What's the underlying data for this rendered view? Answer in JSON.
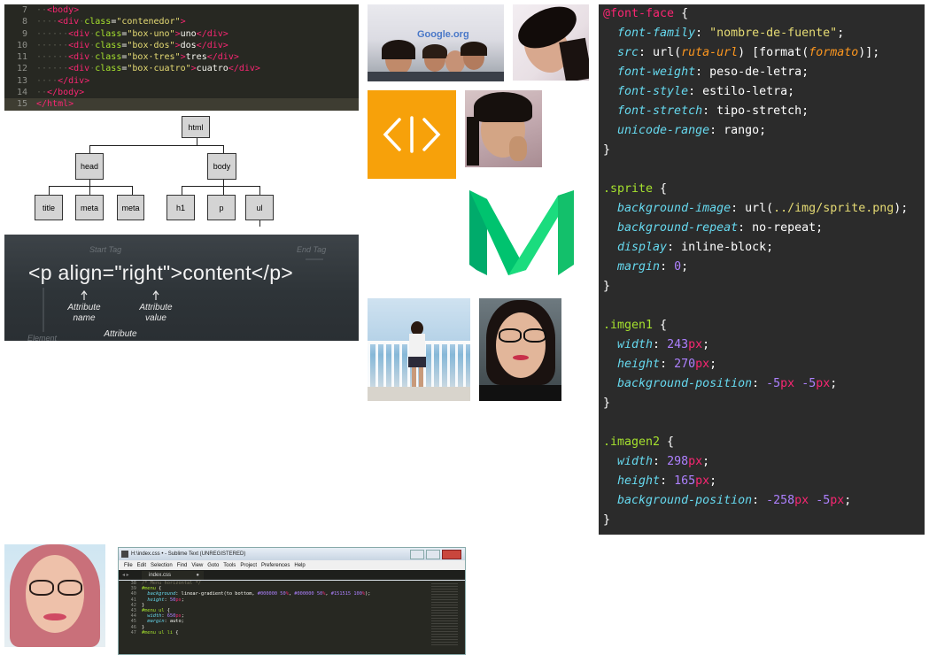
{
  "html_code": {
    "lines": [
      {
        "n": "7",
        "segs": [
          [
            "dt",
            "··"
          ],
          [
            "tg",
            "<body>"
          ]
        ]
      },
      {
        "n": "8",
        "segs": [
          [
            "dt",
            "····"
          ],
          [
            "tg",
            "<div"
          ],
          [
            "dt",
            "·"
          ],
          [
            "at",
            "class"
          ],
          [
            "plain",
            "="
          ],
          [
            "st",
            "\"contenedor\""
          ],
          [
            "tg",
            ">"
          ]
        ]
      },
      {
        "n": "9",
        "segs": [
          [
            "dt",
            "······"
          ],
          [
            "tg",
            "<div"
          ],
          [
            "dt",
            "·"
          ],
          [
            "at",
            "class"
          ],
          [
            "plain",
            "="
          ],
          [
            "st",
            "\"box·uno\""
          ],
          [
            "tg",
            ">"
          ],
          [
            "plain",
            "uno"
          ],
          [
            "tg",
            "</div>"
          ]
        ]
      },
      {
        "n": "10",
        "segs": [
          [
            "dt",
            "······"
          ],
          [
            "tg",
            "<div"
          ],
          [
            "dt",
            "·"
          ],
          [
            "at",
            "class"
          ],
          [
            "plain",
            "="
          ],
          [
            "st",
            "\"box·dos\""
          ],
          [
            "tg",
            ">"
          ],
          [
            "plain",
            "dos"
          ],
          [
            "tg",
            "</div>"
          ]
        ]
      },
      {
        "n": "11",
        "segs": [
          [
            "dt",
            "······"
          ],
          [
            "tg",
            "<div"
          ],
          [
            "dt",
            "·"
          ],
          [
            "at",
            "class"
          ],
          [
            "plain",
            "="
          ],
          [
            "st",
            "\"box·tres\""
          ],
          [
            "tg",
            ">"
          ],
          [
            "plain",
            "tres"
          ],
          [
            "tg",
            "</div>"
          ]
        ]
      },
      {
        "n": "12",
        "segs": [
          [
            "dt",
            "······"
          ],
          [
            "tg",
            "<div"
          ],
          [
            "dt",
            "·"
          ],
          [
            "at",
            "class"
          ],
          [
            "plain",
            "="
          ],
          [
            "st",
            "\"box·cuatro\""
          ],
          [
            "tg",
            ">"
          ],
          [
            "plain",
            "cuatro"
          ],
          [
            "tg",
            "</div>"
          ]
        ]
      },
      {
        "n": "13",
        "segs": [
          [
            "dt",
            "····"
          ],
          [
            "tg",
            "</div>"
          ]
        ]
      },
      {
        "n": "14",
        "segs": [
          [
            "dt",
            "··"
          ],
          [
            "tg",
            "</body>"
          ]
        ]
      },
      {
        "n": "15",
        "segs": [
          [
            "tg",
            "</html>"
          ]
        ]
      }
    ]
  },
  "dom_tree": {
    "root": "html",
    "level1": [
      "head",
      "body"
    ],
    "head_children": [
      "title",
      "meta",
      "meta"
    ],
    "body_children": [
      "h1",
      "p",
      "ul"
    ]
  },
  "chalkboard": {
    "main": "<p align=\"right\">content</p>",
    "start_tag": "Start Tag",
    "end_tag": "End Tag",
    "attr_name": "Attribute\nname",
    "attr_value": "Attribute\nvalue",
    "attribute": "Attribute",
    "element": "Element"
  },
  "photos": {
    "google_sign": "Google.org",
    "code_logo": "<|>"
  },
  "css_code": {
    "lines": [
      [
        [
          "kw",
          "@font-face"
        ],
        [
          "plain",
          " {"
        ]
      ],
      [
        [
          "plain",
          "  "
        ],
        [
          "prop",
          "font-family"
        ],
        [
          "plain",
          ": "
        ],
        [
          "str",
          "\"nombre-de-fuente\""
        ],
        [
          "plain",
          ";"
        ]
      ],
      [
        [
          "plain",
          "  "
        ],
        [
          "prop",
          "src"
        ],
        [
          "plain",
          ": url("
        ],
        [
          "arg",
          "ruta-url"
        ],
        [
          "plain",
          ") [format("
        ],
        [
          "arg",
          "formato"
        ],
        [
          "plain",
          ")];"
        ]
      ],
      [
        [
          "plain",
          "  "
        ],
        [
          "prop",
          "font-weight"
        ],
        [
          "plain",
          ": peso-de-letra;"
        ]
      ],
      [
        [
          "plain",
          "  "
        ],
        [
          "prop",
          "font-style"
        ],
        [
          "plain",
          ": estilo-letra;"
        ]
      ],
      [
        [
          "plain",
          "  "
        ],
        [
          "prop",
          "font-stretch"
        ],
        [
          "plain",
          ": tipo-stretch;"
        ]
      ],
      [
        [
          "plain",
          "  "
        ],
        [
          "prop",
          "unicode-range"
        ],
        [
          "plain",
          ": rango;"
        ]
      ],
      [
        [
          "plain",
          "}"
        ]
      ],
      [
        [
          "plain",
          ""
        ]
      ],
      [
        [
          "sel",
          ".sprite"
        ],
        [
          "plain",
          " {"
        ]
      ],
      [
        [
          "plain",
          "  "
        ],
        [
          "prop",
          "background-image"
        ],
        [
          "plain",
          ": url("
        ],
        [
          "str",
          "../img/sprite.png"
        ],
        [
          "plain",
          ");"
        ]
      ],
      [
        [
          "plain",
          "  "
        ],
        [
          "prop",
          "background-repeat"
        ],
        [
          "plain",
          ": no-repeat;"
        ]
      ],
      [
        [
          "plain",
          "  "
        ],
        [
          "prop",
          "display"
        ],
        [
          "plain",
          ": inline-block;"
        ]
      ],
      [
        [
          "plain",
          "  "
        ],
        [
          "prop",
          "margin"
        ],
        [
          "plain",
          ": "
        ],
        [
          "num",
          "0"
        ],
        [
          "plain",
          ";"
        ]
      ],
      [
        [
          "plain",
          "}"
        ]
      ],
      [
        [
          "plain",
          ""
        ]
      ],
      [
        [
          "sel",
          ".imgen1"
        ],
        [
          "plain",
          " {"
        ]
      ],
      [
        [
          "plain",
          "  "
        ],
        [
          "prop",
          "width"
        ],
        [
          "plain",
          ": "
        ],
        [
          "num",
          "243"
        ],
        [
          "unit",
          "px"
        ],
        [
          "plain",
          ";"
        ]
      ],
      [
        [
          "plain",
          "  "
        ],
        [
          "prop",
          "height"
        ],
        [
          "plain",
          ": "
        ],
        [
          "num",
          "270"
        ],
        [
          "unit",
          "px"
        ],
        [
          "plain",
          ";"
        ]
      ],
      [
        [
          "plain",
          "  "
        ],
        [
          "prop",
          "background-position"
        ],
        [
          "plain",
          ": "
        ],
        [
          "num",
          "-5"
        ],
        [
          "unit",
          "px"
        ],
        [
          "plain",
          " "
        ],
        [
          "num",
          "-5"
        ],
        [
          "unit",
          "px"
        ],
        [
          "plain",
          ";"
        ]
      ],
      [
        [
          "plain",
          "}"
        ]
      ],
      [
        [
          "plain",
          ""
        ]
      ],
      [
        [
          "sel",
          ".imagen2"
        ],
        [
          "plain",
          " {"
        ]
      ],
      [
        [
          "plain",
          "  "
        ],
        [
          "prop",
          "width"
        ],
        [
          "plain",
          ": "
        ],
        [
          "num",
          "298"
        ],
        [
          "unit",
          "px"
        ],
        [
          "plain",
          ";"
        ]
      ],
      [
        [
          "plain",
          "  "
        ],
        [
          "prop",
          "height"
        ],
        [
          "plain",
          ": "
        ],
        [
          "num",
          "165"
        ],
        [
          "unit",
          "px"
        ],
        [
          "plain",
          ";"
        ]
      ],
      [
        [
          "plain",
          "  "
        ],
        [
          "prop",
          "background-position"
        ],
        [
          "plain",
          ": "
        ],
        [
          "num",
          "-258"
        ],
        [
          "unit",
          "px"
        ],
        [
          "plain",
          " "
        ],
        [
          "num",
          "-5"
        ],
        [
          "unit",
          "px"
        ],
        [
          "plain",
          ";"
        ]
      ],
      [
        [
          "plain",
          "}"
        ]
      ]
    ]
  },
  "sublime": {
    "title": "H:\\index.css • - Sublime Text (UNREGISTERED)",
    "menu": [
      "File",
      "Edit",
      "Selection",
      "Find",
      "View",
      "Goto",
      "Tools",
      "Project",
      "Preferences",
      "Help"
    ],
    "tab": "index.css",
    "lines": [
      {
        "n": "38",
        "segs": [
          [
            "cm",
            "/* Menu horizontal */"
          ]
        ]
      },
      {
        "n": "39",
        "segs": [
          [
            "sel",
            "#menu"
          ],
          [
            "plain",
            " {"
          ]
        ]
      },
      {
        "n": "40",
        "segs": [
          [
            "plain",
            "  "
          ],
          [
            "prop",
            "background"
          ],
          [
            "plain",
            ": linear-gradient(to bottom, "
          ],
          [
            "num",
            "#000000"
          ],
          [
            "plain",
            " "
          ],
          [
            "num",
            "50"
          ],
          [
            "unit",
            "%"
          ],
          [
            "plain",
            ", "
          ],
          [
            "num",
            "#000000"
          ],
          [
            "plain",
            " "
          ],
          [
            "num",
            "50"
          ],
          [
            "unit",
            "%"
          ],
          [
            "plain",
            ", "
          ],
          [
            "num",
            "#151515"
          ],
          [
            "plain",
            " "
          ],
          [
            "num",
            "100"
          ],
          [
            "unit",
            "%"
          ],
          [
            "plain",
            ");"
          ]
        ]
      },
      {
        "n": "41",
        "segs": [
          [
            "plain",
            "  "
          ],
          [
            "prop",
            "height"
          ],
          [
            "plain",
            ": "
          ],
          [
            "num",
            "50"
          ],
          [
            "unit",
            "px"
          ],
          [
            "plain",
            ";"
          ]
        ]
      },
      {
        "n": "42",
        "segs": [
          [
            "plain",
            "}"
          ]
        ]
      },
      {
        "n": "43",
        "segs": [
          [
            "sel",
            "#menu ul"
          ],
          [
            "plain",
            " {"
          ]
        ]
      },
      {
        "n": "44",
        "segs": [
          [
            "plain",
            "  "
          ],
          [
            "prop",
            "width"
          ],
          [
            "plain",
            ": "
          ],
          [
            "num",
            "650"
          ],
          [
            "unit",
            "px"
          ],
          [
            "plain",
            ";"
          ]
        ]
      },
      {
        "n": "45",
        "segs": [
          [
            "plain",
            "  "
          ],
          [
            "prop",
            "margin"
          ],
          [
            "plain",
            ": auto;"
          ]
        ]
      },
      {
        "n": "46",
        "segs": [
          [
            "plain",
            "}"
          ]
        ]
      },
      {
        "n": "47",
        "segs": [
          [
            "sel",
            "#menu ul li"
          ],
          [
            "plain",
            " {"
          ]
        ]
      }
    ]
  },
  "colors": {
    "orange": "#f7a10a",
    "medium_green_dark": "#00ab6b",
    "medium_green_light": "#1bdc7e"
  }
}
